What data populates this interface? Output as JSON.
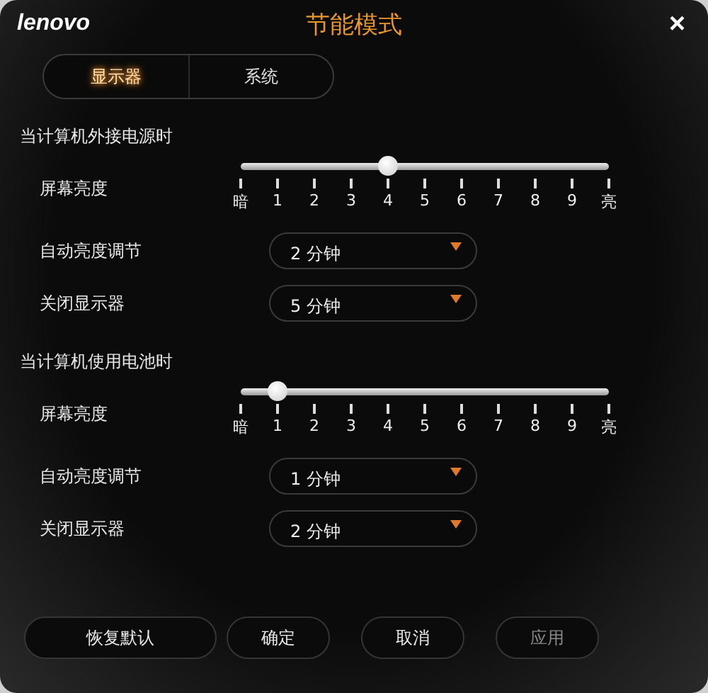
{
  "window": {
    "logo": "lenovo",
    "title": "节能模式",
    "close": "×"
  },
  "tabs": [
    {
      "label": "显示器",
      "selected": true
    },
    {
      "label": "系统",
      "selected": false
    }
  ],
  "sections": [
    {
      "heading": "当计算机外接电源时",
      "brightness": {
        "label": "屏幕亮度",
        "level": 0.4,
        "ticks": [
          "暗",
          "1",
          "2",
          "3",
          "4",
          "5",
          "6",
          "7",
          "8",
          "9",
          "亮"
        ]
      },
      "settings": [
        {
          "label": "自动亮度调节",
          "value": "2 分钟"
        },
        {
          "label": "关闭显示器",
          "value": "5 分钟"
        }
      ]
    },
    {
      "heading": "当计算机使用电池时",
      "brightness": {
        "label": "屏幕亮度",
        "level": 0.1,
        "ticks": [
          "暗",
          "1",
          "2",
          "3",
          "4",
          "5",
          "6",
          "7",
          "8",
          "9",
          "亮"
        ]
      },
      "settings": [
        {
          "label": "自动亮度调节",
          "value": "1 分钟"
        },
        {
          "label": "关闭显示器",
          "value": "2 分钟"
        }
      ]
    }
  ],
  "buttons": [
    {
      "label": "恢复默认",
      "disabled": false
    },
    {
      "label": "确定",
      "disabled": false
    },
    {
      "label": "取消",
      "disabled": false
    },
    {
      "label": "应用",
      "disabled": true
    }
  ]
}
